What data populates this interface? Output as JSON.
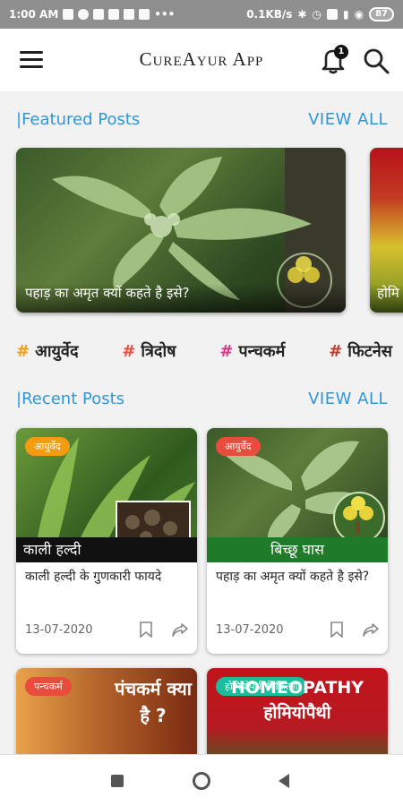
{
  "status_bar": {
    "time": "1:00 AM",
    "net_speed": "0.1KB/s",
    "battery": "87"
  },
  "app": {
    "title": "CureAyur App",
    "notification_count": "1"
  },
  "featured": {
    "title": "|Featured Posts",
    "view_all": "VIEW ALL",
    "posts": [
      {
        "caption": "पहाड़ का अमृत क्यों कहते है इसे?"
      },
      {
        "caption": "होमि"
      }
    ]
  },
  "tags": [
    {
      "hash": "#",
      "label": "आयुर्वेद",
      "hash_color": "#f39c12"
    },
    {
      "hash": "#",
      "label": "त्रिदोष",
      "hash_color": "#e74c3c"
    },
    {
      "hash": "#",
      "label": "पन्चकर्म",
      "hash_color": "#d63384"
    },
    {
      "hash": "#",
      "label": "फिटनेस",
      "hash_color": "#c0392b"
    }
  ],
  "recent": {
    "title": "|Recent Posts",
    "view_all": "VIEW ALL",
    "posts": [
      {
        "category": "आयुर्वेद",
        "category_color": "#f39c12",
        "banner": "काली हल्दी",
        "banner_color": "#111111",
        "title": "काली हल्दी के गुणकारी फायदे",
        "date": "13-07-2020"
      },
      {
        "category": "आयुर्वेद",
        "category_color": "#e74c3c",
        "banner": "बिच्छू घास",
        "banner_color": "#1f7a2a",
        "title": "पहाड़ का अमृत क्यों कहते है इसे?",
        "date": "13-07-2020"
      },
      {
        "category": "पन्चकर्म",
        "category_color": "#e74c3c",
        "banner": "पंचकर्म क्या है ?"
      },
      {
        "category": "होमियोपैथी चिकित्सा",
        "category_color": "#1abc9c",
        "banner": "HOMEOPATHY होमियोपैथी"
      }
    ]
  },
  "colors": {
    "accent": "#2f97d8",
    "status_bar": "#8f8f8f"
  },
  "icons": [
    "menu-icon",
    "bell-icon",
    "search-icon",
    "bookmark-icon",
    "share-icon",
    "nav-recents-icon",
    "nav-home-icon",
    "nav-back-icon"
  ]
}
